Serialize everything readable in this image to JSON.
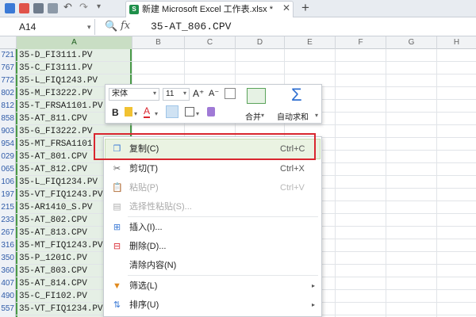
{
  "top_bar": {
    "document_tab": "新建 Microsoft Excel 工作表.xlsx *",
    "close_glyph": "✕",
    "new_tab_glyph": "+"
  },
  "formula_bar": {
    "name_box": "A14",
    "fx_label": "fx",
    "formula": "35-AT_806.CPV"
  },
  "columns": [
    "A",
    "B",
    "C",
    "D",
    "E",
    "F",
    "G",
    "H"
  ],
  "rows": [
    {
      "num": "721",
      "a": "35-D_FI3111.PV"
    },
    {
      "num": "767",
      "a": "35-C_FI3111.PV"
    },
    {
      "num": "772",
      "a": "35-L_FIQ1243.PV"
    },
    {
      "num": "802",
      "a": "35-M_FI3222.PV"
    },
    {
      "num": "812",
      "a": "35-T_FRSA1101.PV"
    },
    {
      "num": "858",
      "a": "35-AT_811.CPV"
    },
    {
      "num": "903",
      "a": "35-G_FI3222.PV"
    },
    {
      "num": "954",
      "a": "35-MT_FRSA1101"
    },
    {
      "num": "029",
      "a": "35-AT_801.CPV"
    },
    {
      "num": "065",
      "a": "35-AT_812.CPV"
    },
    {
      "num": "106",
      "a": "35-L_FIQ1234.PV"
    },
    {
      "num": "197",
      "a": "35-VT_FIQ1243.PV"
    },
    {
      "num": "215",
      "a": "35-AR1410_S.PV"
    },
    {
      "num": "233",
      "a": "35-AT_802.CPV"
    },
    {
      "num": "267",
      "a": "35-AT_813.CPV"
    },
    {
      "num": "316",
      "a": "35-MT_FIQ1243.PV"
    },
    {
      "num": "350",
      "a": "35-P_1201C.PV"
    },
    {
      "num": "360",
      "a": "35-AT_803.CPV"
    },
    {
      "num": "407",
      "a": "35-AT_814.CPV"
    },
    {
      "num": "490",
      "a": "35-C_FI102.PV"
    },
    {
      "num": "557",
      "a": "35-VT_FIQ1234.PV"
    }
  ],
  "mini_toolbar": {
    "font_name": "宋体",
    "font_size": "11",
    "grow_font": "A⁺",
    "shrink_font": "A⁻",
    "bold": "B",
    "font_color": "A",
    "merge_label": "合并",
    "autosum_label": "自动求和",
    "autosum_symbol": "Σ"
  },
  "context_menu": {
    "items": [
      {
        "icon": "copy-icon",
        "label": "复制(C)",
        "shortcut": "Ctrl+C",
        "enabled": true,
        "highlighted": true
      },
      {
        "icon": "cut-icon",
        "label": "剪切(T)",
        "shortcut": "Ctrl+X",
        "enabled": true
      },
      {
        "icon": "paste-icon",
        "label": "粘贴(P)",
        "shortcut": "Ctrl+V",
        "enabled": false
      },
      {
        "icon": "paste-special-icon",
        "label": "选择性粘贴(S)...",
        "shortcut": "",
        "enabled": false
      },
      {
        "icon": "insert-icon",
        "label": "插入(I)...",
        "shortcut": "",
        "enabled": true
      },
      {
        "icon": "delete-icon",
        "label": "删除(D)...",
        "shortcut": "",
        "enabled": true
      },
      {
        "icon": "",
        "label": "清除内容(N)",
        "shortcut": "",
        "enabled": true
      },
      {
        "icon": "filter-icon",
        "label": "筛选(L)",
        "shortcut": "",
        "enabled": true,
        "submenu": true
      },
      {
        "icon": "sort-icon",
        "label": "排序(U)",
        "shortcut": "",
        "enabled": true,
        "submenu": true
      }
    ]
  },
  "colors": {
    "selection_green": "#4a9a48",
    "highlight_red": "#d9262f",
    "row_header_blue": "#2f5ba8"
  }
}
